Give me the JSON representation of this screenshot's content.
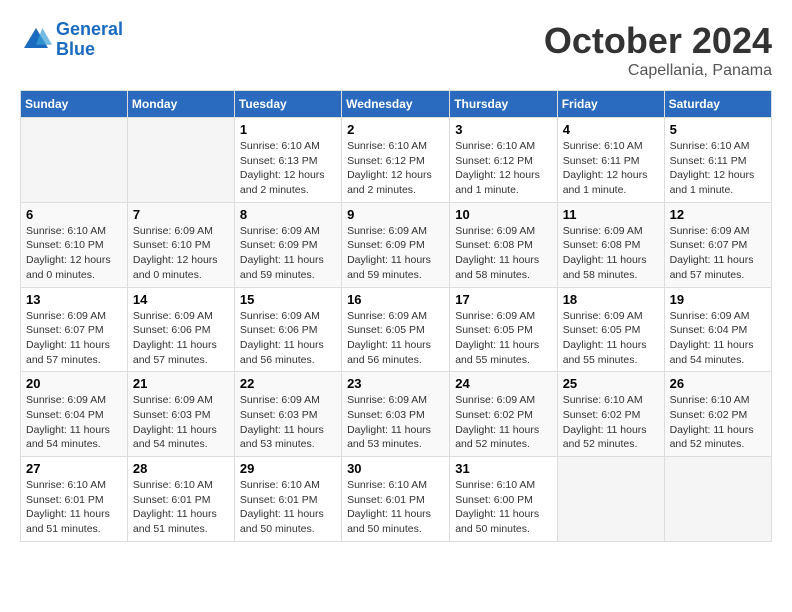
{
  "header": {
    "logo_line1": "General",
    "logo_line2": "Blue",
    "title": "October 2024",
    "subtitle": "Capellania, Panama"
  },
  "calendar": {
    "days_of_week": [
      "Sunday",
      "Monday",
      "Tuesday",
      "Wednesday",
      "Thursday",
      "Friday",
      "Saturday"
    ],
    "weeks": [
      [
        {
          "day": "",
          "info": ""
        },
        {
          "day": "",
          "info": ""
        },
        {
          "day": "1",
          "info": "Sunrise: 6:10 AM\nSunset: 6:13 PM\nDaylight: 12 hours and 2 minutes."
        },
        {
          "day": "2",
          "info": "Sunrise: 6:10 AM\nSunset: 6:12 PM\nDaylight: 12 hours and 2 minutes."
        },
        {
          "day": "3",
          "info": "Sunrise: 6:10 AM\nSunset: 6:12 PM\nDaylight: 12 hours and 1 minute."
        },
        {
          "day": "4",
          "info": "Sunrise: 6:10 AM\nSunset: 6:11 PM\nDaylight: 12 hours and 1 minute."
        },
        {
          "day": "5",
          "info": "Sunrise: 6:10 AM\nSunset: 6:11 PM\nDaylight: 12 hours and 1 minute."
        }
      ],
      [
        {
          "day": "6",
          "info": "Sunrise: 6:10 AM\nSunset: 6:10 PM\nDaylight: 12 hours and 0 minutes."
        },
        {
          "day": "7",
          "info": "Sunrise: 6:09 AM\nSunset: 6:10 PM\nDaylight: 12 hours and 0 minutes."
        },
        {
          "day": "8",
          "info": "Sunrise: 6:09 AM\nSunset: 6:09 PM\nDaylight: 11 hours and 59 minutes."
        },
        {
          "day": "9",
          "info": "Sunrise: 6:09 AM\nSunset: 6:09 PM\nDaylight: 11 hours and 59 minutes."
        },
        {
          "day": "10",
          "info": "Sunrise: 6:09 AM\nSunset: 6:08 PM\nDaylight: 11 hours and 58 minutes."
        },
        {
          "day": "11",
          "info": "Sunrise: 6:09 AM\nSunset: 6:08 PM\nDaylight: 11 hours and 58 minutes."
        },
        {
          "day": "12",
          "info": "Sunrise: 6:09 AM\nSunset: 6:07 PM\nDaylight: 11 hours and 57 minutes."
        }
      ],
      [
        {
          "day": "13",
          "info": "Sunrise: 6:09 AM\nSunset: 6:07 PM\nDaylight: 11 hours and 57 minutes."
        },
        {
          "day": "14",
          "info": "Sunrise: 6:09 AM\nSunset: 6:06 PM\nDaylight: 11 hours and 57 minutes."
        },
        {
          "day": "15",
          "info": "Sunrise: 6:09 AM\nSunset: 6:06 PM\nDaylight: 11 hours and 56 minutes."
        },
        {
          "day": "16",
          "info": "Sunrise: 6:09 AM\nSunset: 6:05 PM\nDaylight: 11 hours and 56 minutes."
        },
        {
          "day": "17",
          "info": "Sunrise: 6:09 AM\nSunset: 6:05 PM\nDaylight: 11 hours and 55 minutes."
        },
        {
          "day": "18",
          "info": "Sunrise: 6:09 AM\nSunset: 6:05 PM\nDaylight: 11 hours and 55 minutes."
        },
        {
          "day": "19",
          "info": "Sunrise: 6:09 AM\nSunset: 6:04 PM\nDaylight: 11 hours and 54 minutes."
        }
      ],
      [
        {
          "day": "20",
          "info": "Sunrise: 6:09 AM\nSunset: 6:04 PM\nDaylight: 11 hours and 54 minutes."
        },
        {
          "day": "21",
          "info": "Sunrise: 6:09 AM\nSunset: 6:03 PM\nDaylight: 11 hours and 54 minutes."
        },
        {
          "day": "22",
          "info": "Sunrise: 6:09 AM\nSunset: 6:03 PM\nDaylight: 11 hours and 53 minutes."
        },
        {
          "day": "23",
          "info": "Sunrise: 6:09 AM\nSunset: 6:03 PM\nDaylight: 11 hours and 53 minutes."
        },
        {
          "day": "24",
          "info": "Sunrise: 6:09 AM\nSunset: 6:02 PM\nDaylight: 11 hours and 52 minutes."
        },
        {
          "day": "25",
          "info": "Sunrise: 6:10 AM\nSunset: 6:02 PM\nDaylight: 11 hours and 52 minutes."
        },
        {
          "day": "26",
          "info": "Sunrise: 6:10 AM\nSunset: 6:02 PM\nDaylight: 11 hours and 52 minutes."
        }
      ],
      [
        {
          "day": "27",
          "info": "Sunrise: 6:10 AM\nSunset: 6:01 PM\nDaylight: 11 hours and 51 minutes."
        },
        {
          "day": "28",
          "info": "Sunrise: 6:10 AM\nSunset: 6:01 PM\nDaylight: 11 hours and 51 minutes."
        },
        {
          "day": "29",
          "info": "Sunrise: 6:10 AM\nSunset: 6:01 PM\nDaylight: 11 hours and 50 minutes."
        },
        {
          "day": "30",
          "info": "Sunrise: 6:10 AM\nSunset: 6:01 PM\nDaylight: 11 hours and 50 minutes."
        },
        {
          "day": "31",
          "info": "Sunrise: 6:10 AM\nSunset: 6:00 PM\nDaylight: 11 hours and 50 minutes."
        },
        {
          "day": "",
          "info": ""
        },
        {
          "day": "",
          "info": ""
        }
      ]
    ]
  }
}
